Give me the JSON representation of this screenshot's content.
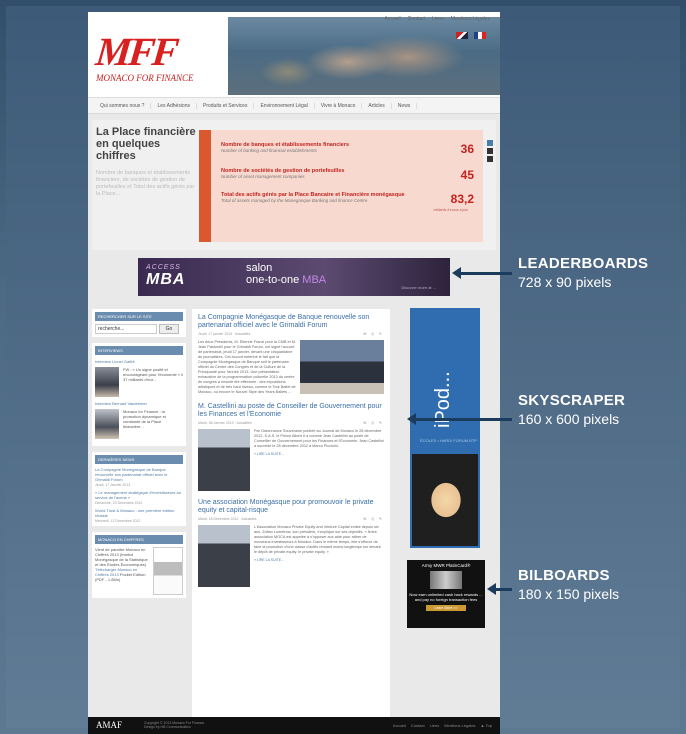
{
  "site": {
    "logo": {
      "letters": "MFF",
      "subtitle": "MONACO FOR FINANCE"
    },
    "top_links": [
      "Accueil",
      "Contact",
      "Liens",
      "Mentions Légales"
    ],
    "nav": [
      "Qui sommes nous ?",
      "Les Adhésions",
      "Produits et Services",
      "Environnement Légal",
      "Vivre à Monaco",
      "Articles",
      "News"
    ],
    "stats": {
      "title": "La Place financière en quelques chiffres",
      "description": "Nombre de banques et établissements financiers, de sociétés de gestion de portefeuilles et Total des actifs gérés par la Place...",
      "rows": [
        {
          "label": "Nombre de banques et établissements financiers",
          "sub": "Number of banking and financial establishments",
          "value": "36",
          "unit": ""
        },
        {
          "label": "Nombre de sociétés de gestion de portefeuilles",
          "sub": "Number of asset management companies",
          "value": "45",
          "unit": ""
        },
        {
          "label": "Total des actifs gérés par la Place Bancaire et Financière monégasque",
          "sub": "Total of assets managed by the Monegasque Banking and finance Centre",
          "value": "83,2",
          "unit": "milliards d'euros à juin"
        }
      ],
      "pager": [
        "1",
        "2",
        "3"
      ]
    },
    "leaderboard_ad": {
      "access": "ACCESS",
      "mba": "MBA",
      "salon": "salon",
      "one_to_one": "one-to-one",
      "one_to_one_accent": "MBA",
      "cta": "Discover more at ..."
    },
    "sidebar": {
      "search_heading": "RECHERCHER SUR LE SITE",
      "search_value": "recherche...",
      "search_button": "Go",
      "interviews_heading": "INTERVIEWS",
      "interviews": [
        {
          "link": "Interview Lionel Galfré",
          "text": "FW : « Un signe positif et encourageant pour l'économie » il 37 milliards d'eur..."
        },
        {
          "link": "Interview Bernard Vaudremer",
          "text": "Monaco for Finance : la promotion dynamique et constante de la Place financière..."
        }
      ],
      "news_heading": "DERNIÈRES NEWS",
      "news": [
        {
          "title": "La Compagnie Monégasque de Banque renouvelle son partenariat officiel avec le Grimaldi Forum",
          "date": "Jeudi, 17 Janvier 2013"
        },
        {
          "title": "« Le management stratégique d'investisseurs au service de l'avenir »",
          "date": "Dimanche, 23 Décembre 2012"
        },
        {
          "title": "World Trust & Monaco : une première édition réussie",
          "date": "Mercredi, 12 Décembre 2012"
        }
      ],
      "doc_heading": "MONACO EN CHIFFRES",
      "doc_text": "Vient de paraître Monaco en Chiffres 2013 (Institut Monégasque de la Statistique et des Etudes Économiques)",
      "doc_link": "Télécharger Monaco en Chiffres 2013",
      "doc_suffix": "Pocket Edition (PDF - 1.8Mo)"
    },
    "articles": [
      {
        "title": "La Compagnie Monégasque de Banque renouvelle son partenariat officiel avec le Grimaldi Forum",
        "meta": "Jeudi, 17 janvier 2013 · Actualités",
        "tools": "✉ ⎙ ✎",
        "body": "Les deux Présidents, M. Etienne Franzi pour la CMB et M. Jean Pastorelli pour le Grimaldi Forum, ont signé l'accord de partenariat, jeudi 17 janvier, devant une cinquantaine de journalistes. Cet accord entérine le fait que la Compagnie Monégasque de Banque soit le partenaire officiel du Centre des Congrès et de la Culture de la Principauté pour l'année 2013. Une présentation exhaustive de la programmation culturelle 2013 du centre de congrès a ensuite été effectuée : des expositions artistiques et de très haut niveau, comme le Tour Ballet de Monaco, ou encore le Nouvel Style des Years Ballets ...",
        "read_more": ""
      },
      {
        "title": "M. Castellini au poste de Conseiller de Gouvernement pour les Finances et l'Economie",
        "meta": "Mardi, 08 Janvier 2013 · Actualités",
        "tools": "✉ ⎙ ✎",
        "body": "Par Ordonnance Souveraine publiée au Journal de Monaco le 28 décembre 2012, S.A.S. le Prince Albert II a nommé Jean Castellini au poste de Conseiller de Gouvernement pour les Finances et l'Économie. Jean Castellini a succédé le 28 décembre 2012 à Marco Piccinini.",
        "read_more": "» LIRE LA SUITE..."
      },
      {
        "title": "Une association Monégasque pour promouvoir le private equity et capital-risque",
        "meta": "Mardi, 18 Décembre 2012 · Actualités",
        "tools": "✉ ⎙ ✎",
        "body": "L'Association Monaco Private Equity and Venture Capital existe depuis six ans. Zoltan Lumetrow, son président, s'explique sur ses objectifs. « Notre association MOCA est appelée à s'opposer aux aide pour attirer de nouveaux investisseurs à Monaco. Dans le même temps, elle s'efforce de faire la promotion d'une classe d'actifs rendant moins longtemps sur devant le dépôt de private equity. le private equity. »",
        "read_more": "» LIRE LA SUITE..."
      }
    ],
    "skyscraper_ad": {
      "text": "iPod...",
      "logo": "ÉCOLES • HARDI FORUM BTP"
    },
    "billboard_ad": {
      "title": "Army MWR PlatinCard®",
      "text": "Now earn unlimited cash back rewards ... and pay no foreign transaction fees",
      "button": "Learn More >>"
    },
    "footer": {
      "logo": "AMAF",
      "copyright": "Copyright © 2013 Monaco For Finance",
      "credit": "Design by HB Communication",
      "links": [
        "Accueil",
        "Contact",
        "Liens",
        "Mentions Légales",
        "▲ Top"
      ]
    }
  },
  "annotations": [
    {
      "title": "LEADERBOARDS",
      "dims": "728 x 90 pixels"
    },
    {
      "title": "SKYSCRAPER",
      "dims": "160 x 600 pixels"
    },
    {
      "title": "BILBOARDS",
      "dims": "180 x 150 pixels"
    }
  ]
}
